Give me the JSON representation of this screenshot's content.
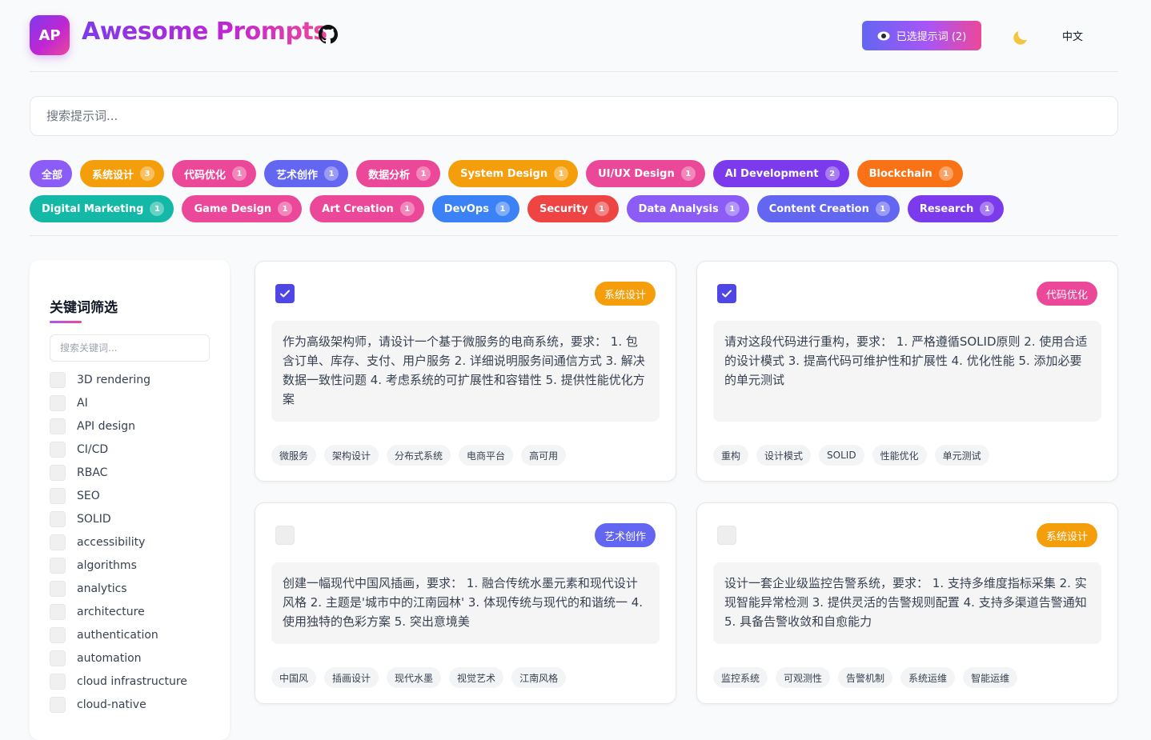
{
  "header": {
    "logo_text": "AP",
    "title": "Awesome Prompts",
    "selected_button": "已选提示词 (2)",
    "language": "中文"
  },
  "search": {
    "placeholder": "搜索提示词..."
  },
  "categories": {
    "row1": [
      {
        "label": "全部",
        "count": "",
        "color": "#8b5cf6"
      },
      {
        "label": "系统设计",
        "count": "3",
        "color": "#f59e0b"
      },
      {
        "label": "代码优化",
        "count": "1",
        "color": "#ec4899"
      },
      {
        "label": "艺术创作",
        "count": "1",
        "color": "#6366f1"
      },
      {
        "label": "数据分析",
        "count": "1",
        "color": "#ec4899"
      },
      {
        "label": "System Design",
        "count": "1",
        "color": "#f59e0b"
      },
      {
        "label": "UI/UX Design",
        "count": "1",
        "color": "#ec4899"
      },
      {
        "label": "AI Development",
        "count": "2",
        "color": "#7c3aed"
      },
      {
        "label": "Blockchain",
        "count": "1",
        "color": "#f97316"
      }
    ],
    "row2": [
      {
        "label": "Digital Marketing",
        "count": "1",
        "color": "#14b8a6"
      },
      {
        "label": "Game Design",
        "count": "1",
        "color": "#ec4899"
      },
      {
        "label": "Art Creation",
        "count": "1",
        "color": "#ec4899"
      },
      {
        "label": "DevOps",
        "count": "1",
        "color": "#3b82f6"
      },
      {
        "label": "Security",
        "count": "1",
        "color": "#ef4444"
      },
      {
        "label": "Data Analysis",
        "count": "1",
        "color": "#8b5cf6"
      },
      {
        "label": "Content Creation",
        "count": "1",
        "color": "#6366f1"
      },
      {
        "label": "Research",
        "count": "1",
        "color": "#7c3aed"
      }
    ]
  },
  "sidebar": {
    "title": "关键词筛选",
    "search_placeholder": "搜索关键词...",
    "keywords": [
      "3D rendering",
      "AI",
      "API design",
      "CI/CD",
      "RBAC",
      "SEO",
      "SOLID",
      "accessibility",
      "algorithms",
      "analytics",
      "architecture",
      "authentication",
      "automation",
      "cloud infrastructure",
      "cloud-native"
    ]
  },
  "cards": [
    {
      "checked": true,
      "category": "系统设计",
      "category_color": "#f59e0b",
      "text": "作为高级架构师，请设计一个基于微服务的电商系统，要求： 1. 包含订单、库存、支付、用户服务 2. 详细说明服务间通信方式 3. 解决数据一致性问题 4. 考虑系统的可扩展性和容错性 5. 提供性能优化方案",
      "tags": [
        "微服务",
        "架构设计",
        "分布式系统",
        "电商平台",
        "高可用"
      ]
    },
    {
      "checked": true,
      "category": "代码优化",
      "category_color": "#ec4899",
      "text": "请对这段代码进行重构，要求： 1. 严格遵循SOLID原则 2. 使用合适的设计模式 3. 提高代码可维护性和扩展性 4. 优化性能 5. 添加必要的单元测试",
      "tags": [
        "重构",
        "设计模式",
        "SOLID",
        "性能优化",
        "单元测试"
      ]
    },
    {
      "checked": false,
      "category": "艺术创作",
      "category_color": "#6366f1",
      "text": "创建一幅现代中国风插画，要求： 1. 融合传统水墨元素和现代设计风格 2. 主题是'城市中的江南园林' 3. 体现传统与现代的和谐统一 4. 使用独特的色彩方案 5. 突出意境美",
      "tags": [
        "中国风",
        "插画设计",
        "现代水墨",
        "视觉艺术",
        "江南风格"
      ]
    },
    {
      "checked": false,
      "category": "系统设计",
      "category_color": "#f59e0b",
      "text": "设计一套企业级监控告警系统，要求： 1. 支持多维度指标采集 2. 实现智能异常检测 3. 提供灵活的告警规则配置 4. 支持多渠道告警通知 5. 具备告警收敛和自愈能力",
      "tags": [
        "监控系统",
        "可观测性",
        "告警机制",
        "系统运维",
        "智能运维"
      ]
    }
  ]
}
